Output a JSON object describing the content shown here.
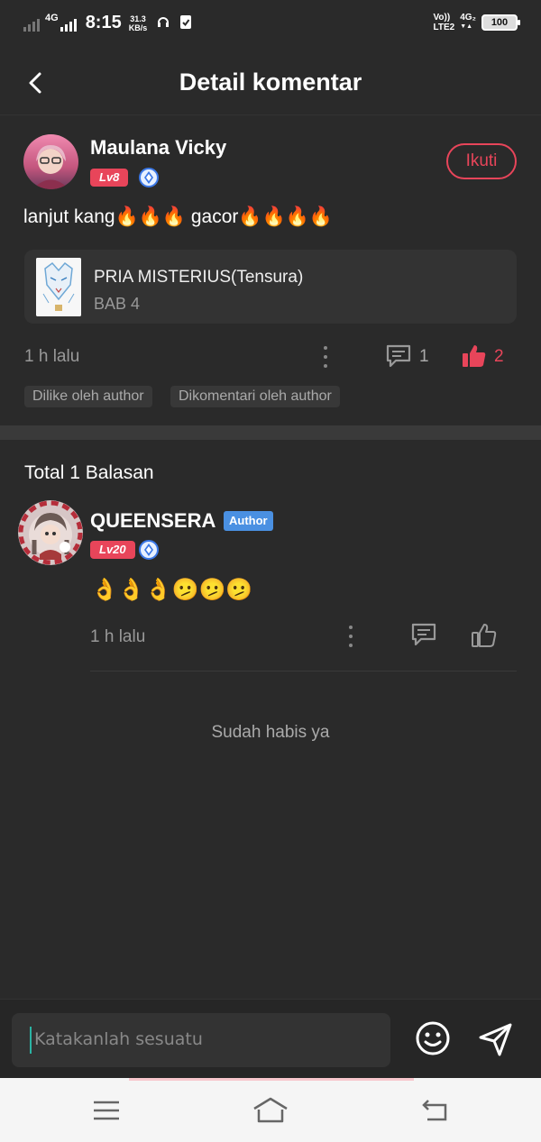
{
  "status_bar": {
    "network": "4G",
    "time": "8:15",
    "speed_value": "31.3",
    "speed_unit": "KB/s",
    "volte_top": "Vo))",
    "volte_bottom": "LTE2",
    "net2_top": "4G₂",
    "net2_bottom": "▼▲",
    "battery": "100"
  },
  "header": {
    "title": "Detail komentar",
    "back_icon": "chevron-left-icon"
  },
  "comment": {
    "username": "Maulana Vicky",
    "level": "Lv8",
    "follow_label": "Ikuti",
    "text": "lanjut kang🔥🔥🔥 gacor🔥🔥🔥🔥",
    "book": {
      "title": "PRIA MISTERIUS(Tensura)",
      "chapter": "BAB 4"
    },
    "time": "1 h lalu",
    "reply_count": "1",
    "like_count": "2",
    "tags": [
      "Dilike oleh author",
      "Dikomentari oleh author"
    ],
    "like_color": "#e8455a"
  },
  "replies": {
    "total_label": "Total 1 Balasan",
    "items": [
      {
        "username": "QUEENSERA",
        "badge": "Author",
        "level": "Lv20",
        "text": "👌👌👌🫤🫤🫤",
        "time": "1 h lalu"
      }
    ],
    "end_label": "Sudah habis ya"
  },
  "input": {
    "placeholder": "Katakanlah sesuatu"
  },
  "colors": {
    "accent": "#e8455a",
    "author_badge": "#4a90e2",
    "background": "#2a2a2a"
  }
}
